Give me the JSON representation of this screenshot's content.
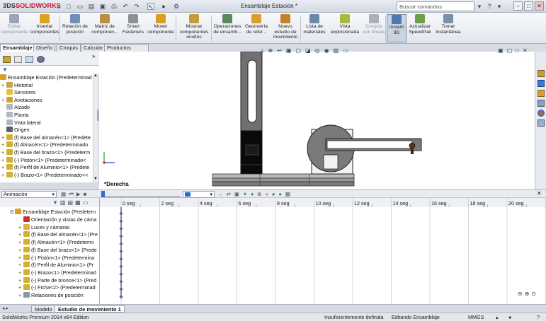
{
  "app": {
    "logo_prefix": "3DS",
    "logo_text": "SOLIDWORKS",
    "title": "Ensamblaje Estación *"
  },
  "search": {
    "placeholder": "Buscar comandos"
  },
  "window_controls": [
    "?",
    "–",
    "□",
    "✕"
  ],
  "ribbon": {
    "items": [
      {
        "label": "Editar componente",
        "disabled": true,
        "color": "#9aa6b8"
      },
      {
        "label": "Insertar componentes",
        "disabled": false,
        "color": "#e0a020"
      },
      {
        "label": "Relación de posición",
        "disabled": false,
        "color": "#6f8fb8"
      },
      {
        "label": "Matriz de componen...",
        "disabled": false,
        "color": "#b88f40"
      },
      {
        "label": "Smart Fasteners",
        "disabled": false,
        "color": "#8a8f98"
      },
      {
        "label": "Mover componente",
        "disabled": false,
        "color": "#d9a020"
      },
      {
        "label": "Mostrar componentes ocultos",
        "disabled": false,
        "color": "#c79b3c"
      },
      {
        "label": "Operaciones de ensamb...",
        "disabled": false,
        "color": "#5c8a5c"
      },
      {
        "label": "Geometría de refer...",
        "disabled": false,
        "color": "#d8a030"
      },
      {
        "label": "Nuevo estudio de movimiento",
        "disabled": false,
        "color": "#c7802a"
      },
      {
        "label": "Lista de materiales",
        "disabled": false,
        "color": "#6a88aa"
      },
      {
        "label": "Vista explosionada",
        "disabled": false,
        "color": "#a8b840"
      },
      {
        "label": "Croquis con líneas ...",
        "disabled": true,
        "color": "#a8b0bc"
      },
      {
        "label": "Instant 3D",
        "disabled": false,
        "active": true,
        "color": "#4d78b0"
      },
      {
        "label": "Actualizar SpeedPak",
        "disabled": false,
        "color": "#6aa04a"
      },
      {
        "label": "Tomar instantánea",
        "disabled": false,
        "color": "#7a8fa8"
      }
    ]
  },
  "tabs": [
    "Ensamblaje",
    "Diseño",
    "Croquis",
    "Calcular",
    "Productos Office"
  ],
  "feature_tree": {
    "root": "Ensamblaje Estación  (Predeterminad",
    "items": [
      {
        "label": "Historial",
        "expand": "+",
        "color": "#c9a24a"
      },
      {
        "label": "Sensores",
        "expand": "",
        "color": "#e6c040"
      },
      {
        "label": "Anotaciones",
        "expand": "+",
        "color": "#d9a030"
      },
      {
        "label": "Alzado",
        "expand": "",
        "color": "#b0b8c4"
      },
      {
        "label": "Planta",
        "expand": "",
        "color": "#b0b8c4"
      },
      {
        "label": "Vista lateral",
        "expand": "",
        "color": "#b0b8c4"
      },
      {
        "label": "Origen",
        "expand": "",
        "color": "#606060"
      },
      {
        "label": "(f) Base del almacén<1> (Predete",
        "expand": "+",
        "color": "#d4b030"
      },
      {
        "label": "(f) Almacén<1> (Predeterminado",
        "expand": "+",
        "color": "#d4b030"
      },
      {
        "label": "(f) Base del brazo<1> (Predeterm",
        "expand": "+",
        "color": "#d4b030"
      },
      {
        "label": "(-) Pistón<1> (Predeterminado<",
        "expand": "+",
        "color": "#d4b030"
      },
      {
        "label": "(f) Perfil de Aluminio<1> (Predete",
        "expand": "+",
        "color": "#d4b030"
      },
      {
        "label": "(-) Brazo<1> (Predeterminado<<",
        "expand": "+",
        "color": "#d4b030"
      }
    ]
  },
  "viewport": {
    "view_label": "*Derecha"
  },
  "motion": {
    "study_type": "Animación",
    "tree_root": "Ensamblaje Estación  (Predetern",
    "tree_items": [
      "Orientación y vistas de cáma",
      "Luces y cámaras",
      "(f) Base del almacén<1> (Pre",
      "(f) Almacén<1> (Predetermi",
      "(f) Base del brazo<1> (Prede",
      "(-) Pistón<1> (Predetermina",
      "(f) Perfil de Aluminio<1> (Pr",
      "(-) Brazo<1> (Predeterminad",
      "(-) Parte de bronce<1> (Pred",
      "(-) Ficha<2> (Predeterminad",
      "Relaciones de posición"
    ],
    "timeline_labels": [
      "0 seg",
      "2 seg",
      "4 seg",
      "6 seg",
      "8 seg",
      "10 seg",
      "12 seg",
      "14 seg",
      "16 seg",
      "18 seg",
      "20 seg"
    ]
  },
  "bottom_tabs": [
    "Modelo",
    "Estudio de movimiento 1"
  ],
  "status": {
    "product": "SolidWorks Premium 2014 x64 Edition",
    "definition": "Insuficientemente definida",
    "mode": "Editando Ensamblaje",
    "units": "MMGS"
  }
}
